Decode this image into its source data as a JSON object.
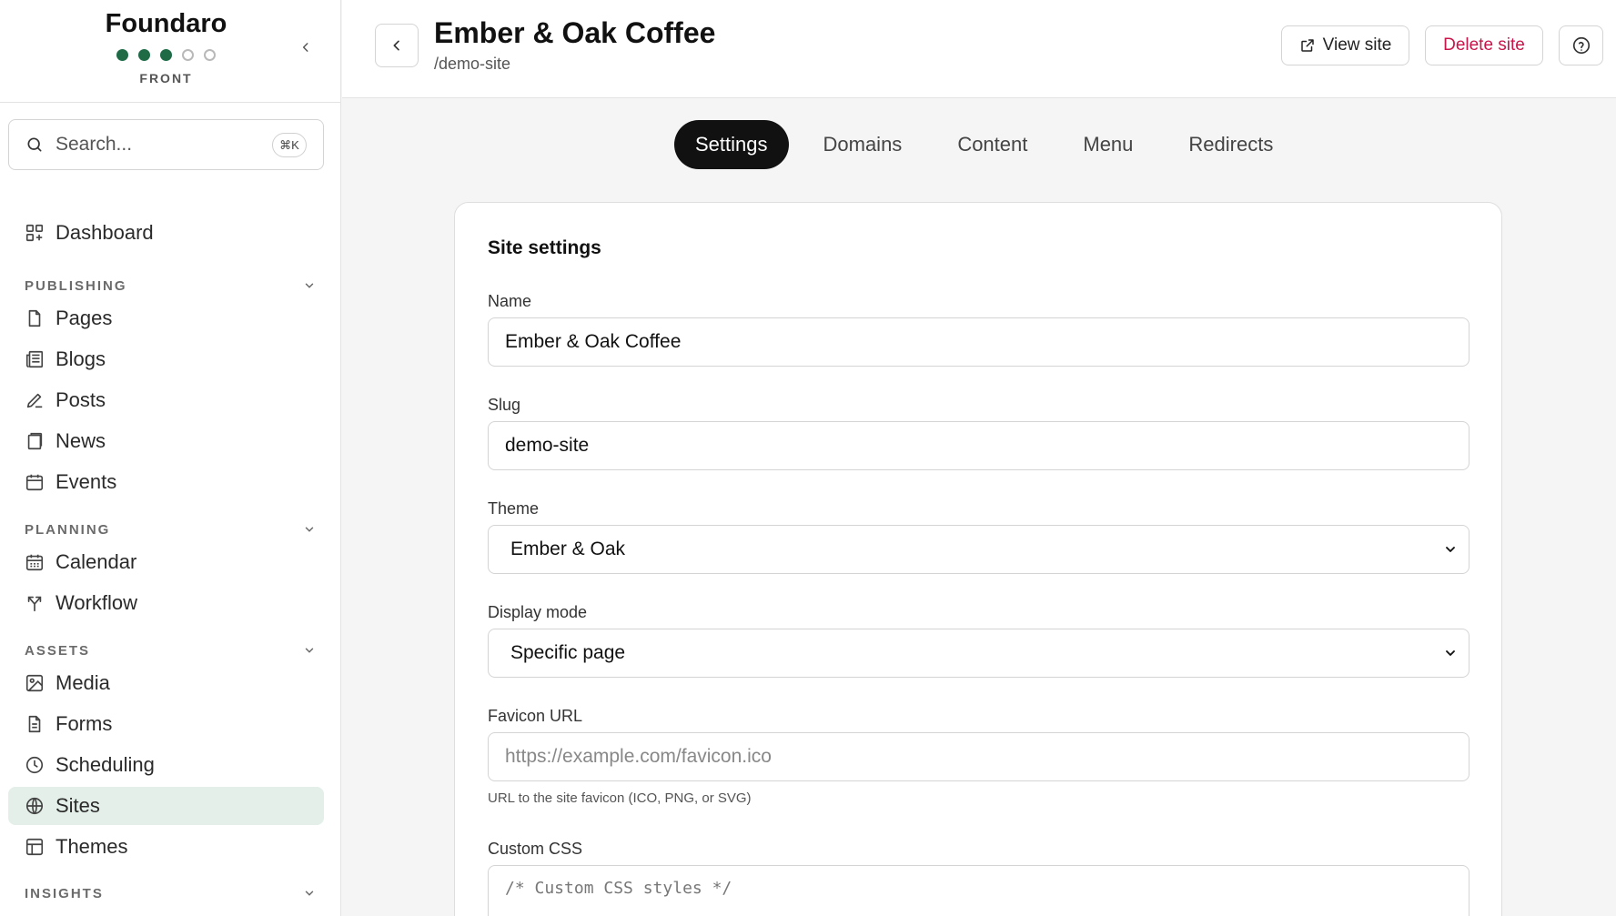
{
  "brand": {
    "name": "Foundaro",
    "sub": "FRONT",
    "progress": {
      "filled": 3,
      "total": 5
    }
  },
  "search": {
    "placeholder": "Search...",
    "shortcut": "⌘K"
  },
  "sidebar": {
    "dashboard": "Dashboard",
    "sections": {
      "publishing": "PUBLISHING",
      "planning": "PLANNING",
      "assets": "ASSETS",
      "insights": "INSIGHTS"
    },
    "items": {
      "pages": "Pages",
      "blogs": "Blogs",
      "posts": "Posts",
      "news": "News",
      "events": "Events",
      "calendar": "Calendar",
      "workflow": "Workflow",
      "media": "Media",
      "forms": "Forms",
      "scheduling": "Scheduling",
      "sites": "Sites",
      "themes": "Themes"
    },
    "active": "sites"
  },
  "header": {
    "title": "Ember & Oak Coffee",
    "path": "/demo-site",
    "view_site": "View site",
    "delete_site": "Delete site"
  },
  "tabs": [
    "Settings",
    "Domains",
    "Content",
    "Menu",
    "Redirects"
  ],
  "active_tab": "Settings",
  "form": {
    "title": "Site settings",
    "name_label": "Name",
    "name_value": "Ember & Oak Coffee",
    "slug_label": "Slug",
    "slug_value": "demo-site",
    "theme_label": "Theme",
    "theme_value": "Ember & Oak",
    "display_label": "Display mode",
    "display_value": "Specific page",
    "favicon_label": "Favicon URL",
    "favicon_placeholder": "https://example.com/favicon.ico",
    "favicon_hint": "URL to the site favicon (ICO, PNG, or SVG)",
    "css_label": "Custom CSS",
    "css_placeholder": "/* Custom CSS styles */"
  },
  "colors": {
    "accent": "#1e6b46",
    "active_bg": "#e3efe8",
    "danger": "#c8154a"
  }
}
